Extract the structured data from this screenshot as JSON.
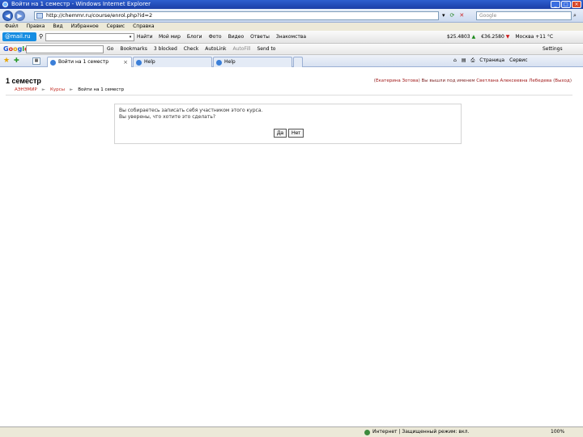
{
  "window": {
    "title": "Войти на 1 семестр - Windows Internet Explorer",
    "buttons": [
      "_",
      "□",
      "×"
    ]
  },
  "address": {
    "url": "http://chemmr.ru/course/enrol.php?id=2",
    "search_placeholder": "Google"
  },
  "menu": [
    "Файл",
    "Правка",
    "Вид",
    "Избранное",
    "Сервис",
    "Справка"
  ],
  "mailru": {
    "logo": "@mail.ru",
    "search_value": "",
    "find_label": "Найти",
    "items": [
      "Мой мир",
      "Блоги",
      "Фото",
      "Видео",
      "Ответы",
      "Знакомства"
    ],
    "usd": "$25.4803",
    "eur": "€36.2580",
    "weather": "Москва +11 °C"
  },
  "google": {
    "logo_letters": [
      "G",
      "o",
      "o",
      "g",
      "l",
      "e"
    ],
    "go_label": "Go",
    "items": [
      "Bookmarks",
      "3 blocked",
      "Check",
      "AutoLink",
      "AutoFill",
      "Send to"
    ],
    "settings": "Settings"
  },
  "tabs": [
    {
      "label": "Войти на 1 семестр",
      "active": true
    },
    {
      "label": "Help",
      "active": false
    },
    {
      "label": "Help",
      "active": false
    }
  ],
  "commands": [
    "Страница",
    "Сервис"
  ],
  "page": {
    "course_title": "1 семестр",
    "user_prefix": "(",
    "user_link1": "Екатерина Зотова",
    "user_mid": ") Вы вышли под именем",
    "user_link2": "Светлана Алексеевна Лебедева",
    "user_suffix": "(",
    "user_logout": "Выход",
    "user_close": ")",
    "breadcrumbs": [
      "АЭНЭМИР",
      "Курсы",
      "Войти на 1 семестр"
    ],
    "confirm_line1": "Вы собираетесь записать себя участником этого курса.",
    "confirm_line2": "Вы уверены, что хотите это сделать?",
    "yes_label": "Да",
    "no_label": "Нет"
  },
  "status": {
    "zone": "Интернет | Защищенный режим: вкл.",
    "zoom": "100%"
  }
}
